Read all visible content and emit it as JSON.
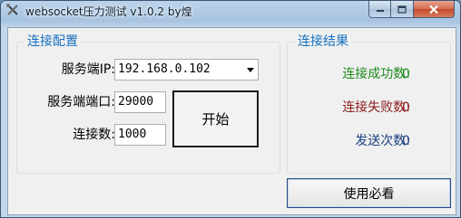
{
  "window": {
    "title": "websocket压力测试 v1.0.2 by煌"
  },
  "icons": {
    "app": "tools-icon",
    "minimize": "minimize-icon",
    "maximize": "maximize-icon",
    "close": "close-icon",
    "dropdown": "chevron-down-icon"
  },
  "connection_config": {
    "group_title": "连接配置",
    "server_ip_label": "服务端IP:",
    "server_ip_value": "192.168.0.102",
    "server_port_label": "服务端端口:",
    "server_port_value": "29000",
    "connection_count_label": "连接数:",
    "connection_count_value": "1000",
    "start_button": "开始"
  },
  "connection_results": {
    "group_title": "连接结果",
    "success_label": "连接成功数:",
    "success_value": "0",
    "failure_label": "连接失败数:",
    "failure_value": "0",
    "sent_label": "发送次数:",
    "sent_value": "0"
  },
  "help_button": "使用必看",
  "colors": {
    "group_title": "#1570c0",
    "success": "#1e8a1e",
    "failure": "#8b1a1a",
    "sent": "#1a3f80",
    "close_button": "#c24a2c"
  }
}
